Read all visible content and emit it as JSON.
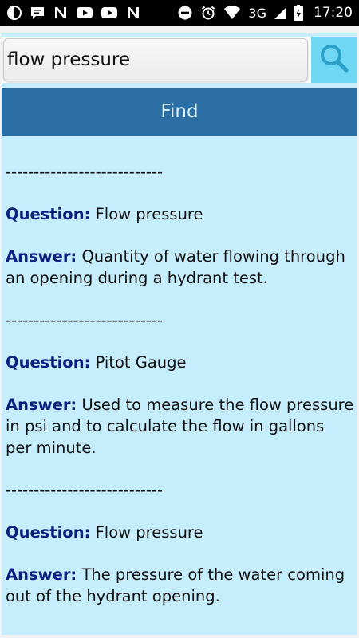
{
  "status_bar": {
    "network_label": "3G",
    "time": "17:20"
  },
  "search": {
    "value": "flow pressure",
    "placeholder": ""
  },
  "find_button_label": "Find",
  "results": [
    {
      "separator": "----------------------------",
      "question_label": "Question:",
      "question": "Flow pressure",
      "answer_label": "Answer:",
      "answer": "Quantity of water flowing through an opening during a hydrant test."
    },
    {
      "separator": "----------------------------",
      "question_label": "Question:",
      "question": "Pitot Gauge",
      "answer_label": "Answer:",
      "answer": "Used to measure the flow pressure in psi and to calculate the flow in gallons per minute."
    },
    {
      "separator": "----------------------------",
      "question_label": "Question:",
      "question": "Flow pressure",
      "answer_label": "Answer:",
      "answer": "The pressure of the water coming out of the hydrant opening."
    }
  ]
}
